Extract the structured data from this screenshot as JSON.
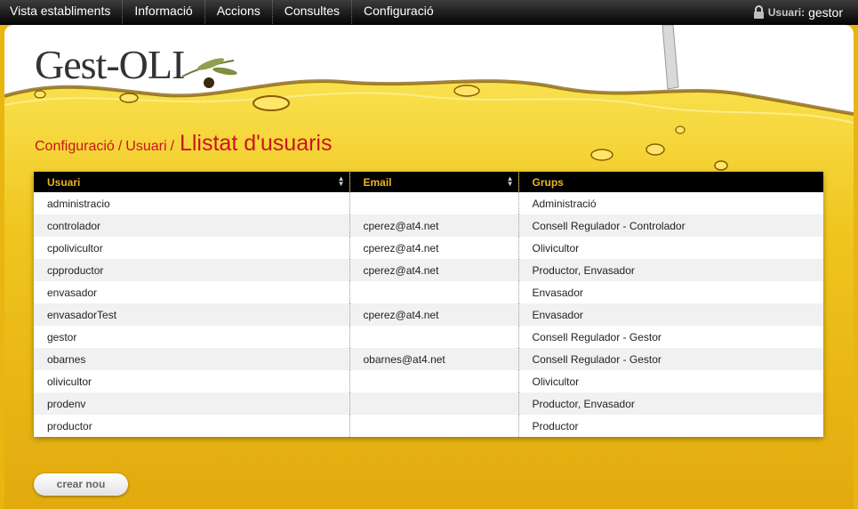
{
  "nav": {
    "items": [
      "Vista establiments",
      "Informació",
      "Accions",
      "Consultes",
      "Configuració"
    ],
    "user_label": "Usuari:",
    "user_value": "gestor"
  },
  "header": {
    "logo_text": "Gest-OLI"
  },
  "breadcrumb": {
    "items": [
      "Configuració",
      "Usuari"
    ],
    "separator": "/",
    "title": "Llistat d'usuaris"
  },
  "table": {
    "columns": [
      "Usuari",
      "Email",
      "Grups"
    ],
    "rows": [
      [
        "administracio",
        "",
        "Administració"
      ],
      [
        "controlador",
        "cperez@at4.net",
        "Consell Regulador - Controlador"
      ],
      [
        "cpolivicultor",
        "cperez@at4.net",
        "Olivicultor"
      ],
      [
        "cpproductor",
        "cperez@at4.net",
        "Productor, Envasador"
      ],
      [
        "envasador",
        "",
        "Envasador"
      ],
      [
        "envasadorTest",
        "cperez@at4.net",
        "Envasador"
      ],
      [
        "gestor",
        "",
        "Consell Regulador - Gestor"
      ],
      [
        "obarnes",
        "obarnes@at4.net",
        "Consell Regulador - Gestor"
      ],
      [
        "olivicultor",
        "",
        "Olivicultor"
      ],
      [
        "prodenv",
        "",
        "Productor, Envasador"
      ],
      [
        "productor",
        "",
        "Productor"
      ]
    ]
  },
  "actions": {
    "create_label": "crear nou"
  },
  "colors": {
    "accent": "#c8161d",
    "oil": "#e9b511",
    "header_text": "#ebb31c"
  },
  "icons": {
    "user": "padlock-icon",
    "sort": "sort-icon"
  }
}
